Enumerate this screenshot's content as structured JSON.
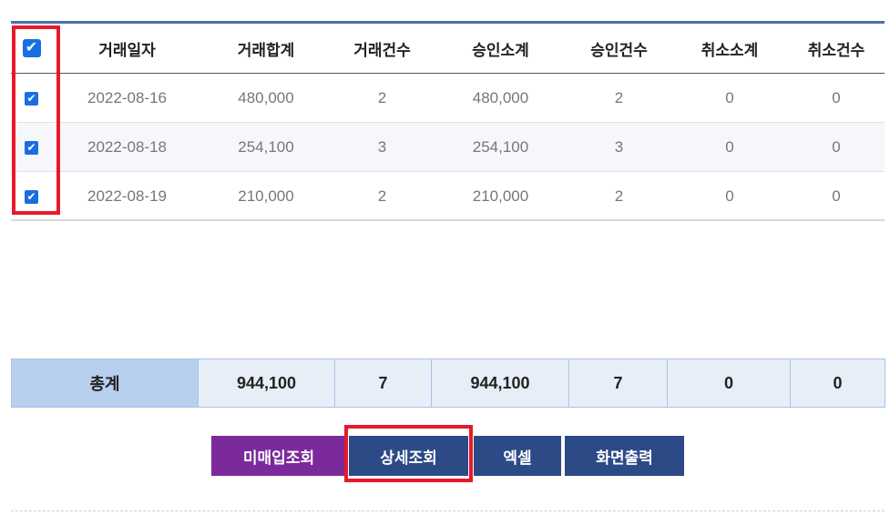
{
  "columns": [
    "거래일자",
    "거래합계",
    "거래건수",
    "승인소계",
    "승인건수",
    "취소소계",
    "취소건수"
  ],
  "check_mark": "✔",
  "rows": [
    {
      "date": "2022-08-16",
      "total": "480,000",
      "count": "2",
      "approved_sum": "480,000",
      "approved_count": "2",
      "cancel_sum": "0",
      "cancel_count": "0"
    },
    {
      "date": "2022-08-18",
      "total": "254,100",
      "count": "3",
      "approved_sum": "254,100",
      "approved_count": "3",
      "cancel_sum": "0",
      "cancel_count": "0"
    },
    {
      "date": "2022-08-19",
      "total": "210,000",
      "count": "2",
      "approved_sum": "210,000",
      "approved_count": "2",
      "cancel_sum": "0",
      "cancel_count": "0"
    }
  ],
  "totals": {
    "label": "총계",
    "total": "944,100",
    "count": "7",
    "approved_sum": "944,100",
    "approved_count": "7",
    "cancel_sum": "0",
    "cancel_count": "0"
  },
  "buttons": {
    "unpurchased": "미매입조회",
    "detail": "상세조회",
    "excel": "엑셀",
    "print": "화면출력"
  },
  "colors": {
    "header_line": "#4a6fb0",
    "checkbox": "#1a6ee0",
    "highlight": "#e8192c",
    "btn_purple": "#7b2a9c",
    "btn_navy": "#2c4a86",
    "total_label_bg": "#b8cfee",
    "total_cell_bg": "#e8eef8"
  }
}
